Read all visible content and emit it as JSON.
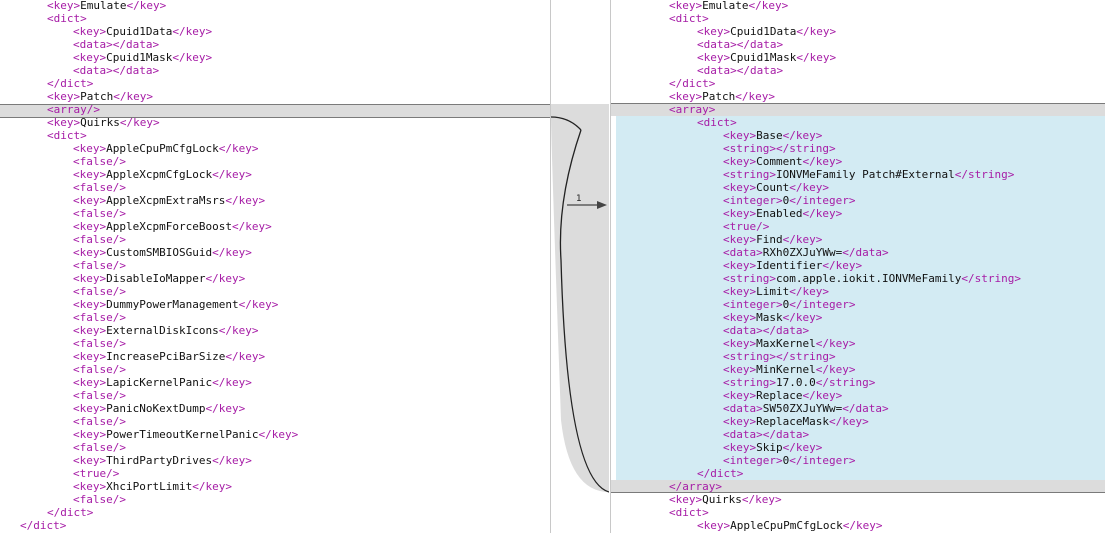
{
  "left_lines": [
    {
      "i": 2,
      "parts": [
        [
          "t",
          "<key>"
        ],
        [
          "x",
          "Emulate"
        ],
        [
          "t",
          "</key>"
        ]
      ]
    },
    {
      "i": 2,
      "parts": [
        [
          "t",
          "<dict>"
        ]
      ]
    },
    {
      "i": 3,
      "parts": [
        [
          "t",
          "<key>"
        ],
        [
          "x",
          "Cpuid1Data"
        ],
        [
          "t",
          "</key>"
        ]
      ]
    },
    {
      "i": 3,
      "parts": [
        [
          "t",
          "<data></data>"
        ]
      ]
    },
    {
      "i": 3,
      "parts": [
        [
          "t",
          "<key>"
        ],
        [
          "x",
          "Cpuid1Mask"
        ],
        [
          "t",
          "</key>"
        ]
      ]
    },
    {
      "i": 3,
      "parts": [
        [
          "t",
          "<data></data>"
        ]
      ]
    },
    {
      "i": 2,
      "parts": [
        [
          "t",
          "</dict>"
        ]
      ]
    },
    {
      "i": 2,
      "parts": [
        [
          "t",
          "<key>"
        ],
        [
          "x",
          "Patch"
        ],
        [
          "t",
          "</key>"
        ]
      ]
    },
    {
      "i": 2,
      "parts": [
        [
          "t",
          "<array/>"
        ]
      ]
    },
    {
      "i": 2,
      "parts": [
        [
          "t",
          "<key>"
        ],
        [
          "x",
          "Quirks"
        ],
        [
          "t",
          "</key>"
        ]
      ]
    },
    {
      "i": 2,
      "parts": [
        [
          "t",
          "<dict>"
        ]
      ]
    },
    {
      "i": 3,
      "parts": [
        [
          "t",
          "<key>"
        ],
        [
          "x",
          "AppleCpuPmCfgLock"
        ],
        [
          "t",
          "</key>"
        ]
      ]
    },
    {
      "i": 3,
      "parts": [
        [
          "t",
          "<false/>"
        ]
      ]
    },
    {
      "i": 3,
      "parts": [
        [
          "t",
          "<key>"
        ],
        [
          "x",
          "AppleXcpmCfgLock"
        ],
        [
          "t",
          "</key>"
        ]
      ]
    },
    {
      "i": 3,
      "parts": [
        [
          "t",
          "<false/>"
        ]
      ]
    },
    {
      "i": 3,
      "parts": [
        [
          "t",
          "<key>"
        ],
        [
          "x",
          "AppleXcpmExtraMsrs"
        ],
        [
          "t",
          "</key>"
        ]
      ]
    },
    {
      "i": 3,
      "parts": [
        [
          "t",
          "<false/>"
        ]
      ]
    },
    {
      "i": 3,
      "parts": [
        [
          "t",
          "<key>"
        ],
        [
          "x",
          "AppleXcpmForceBoost"
        ],
        [
          "t",
          "</key>"
        ]
      ]
    },
    {
      "i": 3,
      "parts": [
        [
          "t",
          "<false/>"
        ]
      ]
    },
    {
      "i": 3,
      "parts": [
        [
          "t",
          "<key>"
        ],
        [
          "x",
          "CustomSMBIOSGuid"
        ],
        [
          "t",
          "</key>"
        ]
      ]
    },
    {
      "i": 3,
      "parts": [
        [
          "t",
          "<false/>"
        ]
      ]
    },
    {
      "i": 3,
      "parts": [
        [
          "t",
          "<key>"
        ],
        [
          "x",
          "DisableIoMapper"
        ],
        [
          "t",
          "</key>"
        ]
      ]
    },
    {
      "i": 3,
      "parts": [
        [
          "t",
          "<false/>"
        ]
      ]
    },
    {
      "i": 3,
      "parts": [
        [
          "t",
          "<key>"
        ],
        [
          "x",
          "DummyPowerManagement"
        ],
        [
          "t",
          "</key>"
        ]
      ]
    },
    {
      "i": 3,
      "parts": [
        [
          "t",
          "<false/>"
        ]
      ]
    },
    {
      "i": 3,
      "parts": [
        [
          "t",
          "<key>"
        ],
        [
          "x",
          "ExternalDiskIcons"
        ],
        [
          "t",
          "</key>"
        ]
      ]
    },
    {
      "i": 3,
      "parts": [
        [
          "t",
          "<false/>"
        ]
      ]
    },
    {
      "i": 3,
      "parts": [
        [
          "t",
          "<key>"
        ],
        [
          "x",
          "IncreasePciBarSize"
        ],
        [
          "t",
          "</key>"
        ]
      ]
    },
    {
      "i": 3,
      "parts": [
        [
          "t",
          "<false/>"
        ]
      ]
    },
    {
      "i": 3,
      "parts": [
        [
          "t",
          "<key>"
        ],
        [
          "x",
          "LapicKernelPanic"
        ],
        [
          "t",
          "</key>"
        ]
      ]
    },
    {
      "i": 3,
      "parts": [
        [
          "t",
          "<false/>"
        ]
      ]
    },
    {
      "i": 3,
      "parts": [
        [
          "t",
          "<key>"
        ],
        [
          "x",
          "PanicNoKextDump"
        ],
        [
          "t",
          "</key>"
        ]
      ]
    },
    {
      "i": 3,
      "parts": [
        [
          "t",
          "<false/>"
        ]
      ]
    },
    {
      "i": 3,
      "parts": [
        [
          "t",
          "<key>"
        ],
        [
          "x",
          "PowerTimeoutKernelPanic"
        ],
        [
          "t",
          "</key>"
        ]
      ]
    },
    {
      "i": 3,
      "parts": [
        [
          "t",
          "<false/>"
        ]
      ]
    },
    {
      "i": 3,
      "parts": [
        [
          "t",
          "<key>"
        ],
        [
          "x",
          "ThirdPartyDrives"
        ],
        [
          "t",
          "</key>"
        ]
      ]
    },
    {
      "i": 3,
      "parts": [
        [
          "t",
          "<true/>"
        ]
      ]
    },
    {
      "i": 3,
      "parts": [
        [
          "t",
          "<key>"
        ],
        [
          "x",
          "XhciPortLimit"
        ],
        [
          "t",
          "</key>"
        ]
      ]
    },
    {
      "i": 3,
      "parts": [
        [
          "t",
          "<false/>"
        ]
      ]
    },
    {
      "i": 2,
      "parts": [
        [
          "t",
          "</dict>"
        ]
      ]
    },
    {
      "i": 1,
      "parts": [
        [
          "t",
          "</dict>"
        ]
      ]
    }
  ],
  "right_lines": [
    {
      "i": 2,
      "parts": [
        [
          "t",
          "<key>"
        ],
        [
          "x",
          "Emulate"
        ],
        [
          "t",
          "</key>"
        ]
      ]
    },
    {
      "i": 2,
      "parts": [
        [
          "t",
          "<dict>"
        ]
      ]
    },
    {
      "i": 3,
      "parts": [
        [
          "t",
          "<key>"
        ],
        [
          "x",
          "Cpuid1Data"
        ],
        [
          "t",
          "</key>"
        ]
      ]
    },
    {
      "i": 3,
      "parts": [
        [
          "t",
          "<data></data>"
        ]
      ]
    },
    {
      "i": 3,
      "parts": [
        [
          "t",
          "<key>"
        ],
        [
          "x",
          "Cpuid1Mask"
        ],
        [
          "t",
          "</key>"
        ]
      ]
    },
    {
      "i": 3,
      "parts": [
        [
          "t",
          "<data></data>"
        ]
      ]
    },
    {
      "i": 2,
      "parts": [
        [
          "t",
          "</dict>"
        ]
      ]
    },
    {
      "i": 2,
      "parts": [
        [
          "t",
          "<key>"
        ],
        [
          "x",
          "Patch"
        ],
        [
          "t",
          "</key>"
        ]
      ]
    },
    {
      "i": 2,
      "parts": [
        [
          "t",
          "<array>"
        ]
      ]
    },
    {
      "i": 3,
      "parts": [
        [
          "t",
          "<dict>"
        ]
      ]
    },
    {
      "i": 4,
      "parts": [
        [
          "t",
          "<key>"
        ],
        [
          "x",
          "Base"
        ],
        [
          "t",
          "</key>"
        ]
      ]
    },
    {
      "i": 4,
      "parts": [
        [
          "t",
          "<string></string>"
        ]
      ]
    },
    {
      "i": 4,
      "parts": [
        [
          "t",
          "<key>"
        ],
        [
          "x",
          "Comment"
        ],
        [
          "t",
          "</key>"
        ]
      ]
    },
    {
      "i": 4,
      "parts": [
        [
          "t",
          "<string>"
        ],
        [
          "x",
          "IONVMeFamily Patch#External"
        ],
        [
          "t",
          "</string>"
        ]
      ]
    },
    {
      "i": 4,
      "parts": [
        [
          "t",
          "<key>"
        ],
        [
          "x",
          "Count"
        ],
        [
          "t",
          "</key>"
        ]
      ]
    },
    {
      "i": 4,
      "parts": [
        [
          "t",
          "<integer>"
        ],
        [
          "x",
          "0"
        ],
        [
          "t",
          "</integer>"
        ]
      ]
    },
    {
      "i": 4,
      "parts": [
        [
          "t",
          "<key>"
        ],
        [
          "x",
          "Enabled"
        ],
        [
          "t",
          "</key>"
        ]
      ]
    },
    {
      "i": 4,
      "parts": [
        [
          "t",
          "<true/>"
        ]
      ]
    },
    {
      "i": 4,
      "parts": [
        [
          "t",
          "<key>"
        ],
        [
          "x",
          "Find"
        ],
        [
          "t",
          "</key>"
        ]
      ]
    },
    {
      "i": 4,
      "parts": [
        [
          "t",
          "<data>"
        ],
        [
          "x",
          "RXh0ZXJuYWw="
        ],
        [
          "t",
          "</data>"
        ]
      ]
    },
    {
      "i": 4,
      "parts": [
        [
          "t",
          "<key>"
        ],
        [
          "x",
          "Identifier"
        ],
        [
          "t",
          "</key>"
        ]
      ]
    },
    {
      "i": 4,
      "parts": [
        [
          "t",
          "<string>"
        ],
        [
          "x",
          "com.apple.iokit.IONVMeFamily"
        ],
        [
          "t",
          "</string>"
        ]
      ]
    },
    {
      "i": 4,
      "parts": [
        [
          "t",
          "<key>"
        ],
        [
          "x",
          "Limit"
        ],
        [
          "t",
          "</key>"
        ]
      ]
    },
    {
      "i": 4,
      "parts": [
        [
          "t",
          "<integer>"
        ],
        [
          "x",
          "0"
        ],
        [
          "t",
          "</integer>"
        ]
      ]
    },
    {
      "i": 4,
      "parts": [
        [
          "t",
          "<key>"
        ],
        [
          "x",
          "Mask"
        ],
        [
          "t",
          "</key>"
        ]
      ]
    },
    {
      "i": 4,
      "parts": [
        [
          "t",
          "<data></data>"
        ]
      ]
    },
    {
      "i": 4,
      "parts": [
        [
          "t",
          "<key>"
        ],
        [
          "x",
          "MaxKernel"
        ],
        [
          "t",
          "</key>"
        ]
      ]
    },
    {
      "i": 4,
      "parts": [
        [
          "t",
          "<string></string>"
        ]
      ]
    },
    {
      "i": 4,
      "parts": [
        [
          "t",
          "<key>"
        ],
        [
          "x",
          "MinKernel"
        ],
        [
          "t",
          "</key>"
        ]
      ]
    },
    {
      "i": 4,
      "parts": [
        [
          "t",
          "<string>"
        ],
        [
          "x",
          "17.0.0"
        ],
        [
          "t",
          "</string>"
        ]
      ]
    },
    {
      "i": 4,
      "parts": [
        [
          "t",
          "<key>"
        ],
        [
          "x",
          "Replace"
        ],
        [
          "t",
          "</key>"
        ]
      ]
    },
    {
      "i": 4,
      "parts": [
        [
          "t",
          "<data>"
        ],
        [
          "x",
          "SW50ZXJuYWw="
        ],
        [
          "t",
          "</data>"
        ]
      ]
    },
    {
      "i": 4,
      "parts": [
        [
          "t",
          "<key>"
        ],
        [
          "x",
          "ReplaceMask"
        ],
        [
          "t",
          "</key>"
        ]
      ]
    },
    {
      "i": 4,
      "parts": [
        [
          "t",
          "<data></data>"
        ]
      ]
    },
    {
      "i": 4,
      "parts": [
        [
          "t",
          "<key>"
        ],
        [
          "x",
          "Skip"
        ],
        [
          "t",
          "</key>"
        ]
      ]
    },
    {
      "i": 4,
      "parts": [
        [
          "t",
          "<integer>"
        ],
        [
          "x",
          "0"
        ],
        [
          "t",
          "</integer>"
        ]
      ]
    },
    {
      "i": 3,
      "parts": [
        [
          "t",
          "</dict>"
        ]
      ]
    },
    {
      "i": 2,
      "parts": [
        [
          "t",
          "</array>"
        ]
      ]
    },
    {
      "i": 2,
      "parts": [
        [
          "t",
          "<key>"
        ],
        [
          "x",
          "Quirks"
        ],
        [
          "t",
          "</key>"
        ]
      ]
    },
    {
      "i": 2,
      "parts": [
        [
          "t",
          "<dict>"
        ]
      ]
    },
    {
      "i": 3,
      "parts": [
        [
          "t",
          "<key>"
        ],
        [
          "x",
          "AppleCpuPmCfgLock"
        ],
        [
          "t",
          "</key>"
        ]
      ]
    }
  ],
  "change": {
    "label": "1",
    "left_row": 8,
    "right_rows": [
      8,
      37
    ]
  },
  "colors": {
    "tag": "#a61ca6",
    "text": "#111111",
    "changed_bg": "#dcdcdc",
    "inserted_bg": "#d3ebf3"
  },
  "icons": {
    "change_connector": "arrow-right-icon"
  }
}
